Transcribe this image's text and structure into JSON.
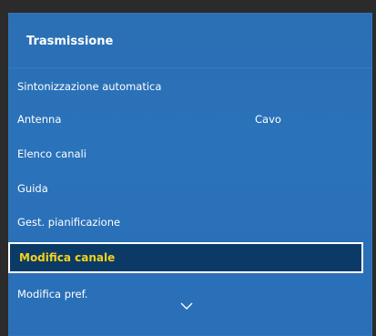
{
  "menu": {
    "title": "Trasmissione",
    "items": [
      {
        "label": "Sintonizzazione automatica",
        "value": ""
      },
      {
        "label": "Antenna",
        "value": "Cavo"
      },
      {
        "label": "Elenco canali",
        "value": ""
      },
      {
        "label": "Guida",
        "value": ""
      },
      {
        "label": "Gest. pianificazione",
        "value": ""
      },
      {
        "label": "Modifica canale",
        "value": "",
        "selected": true
      },
      {
        "label": "Modifica pref.",
        "value": ""
      }
    ],
    "scroll_icon": "chevron-down-icon"
  },
  "colors": {
    "panel_blue": "#2a72ba",
    "selected_bg": "#0b3a66",
    "selected_text": "#f3d21b",
    "text": "#ffffff"
  }
}
